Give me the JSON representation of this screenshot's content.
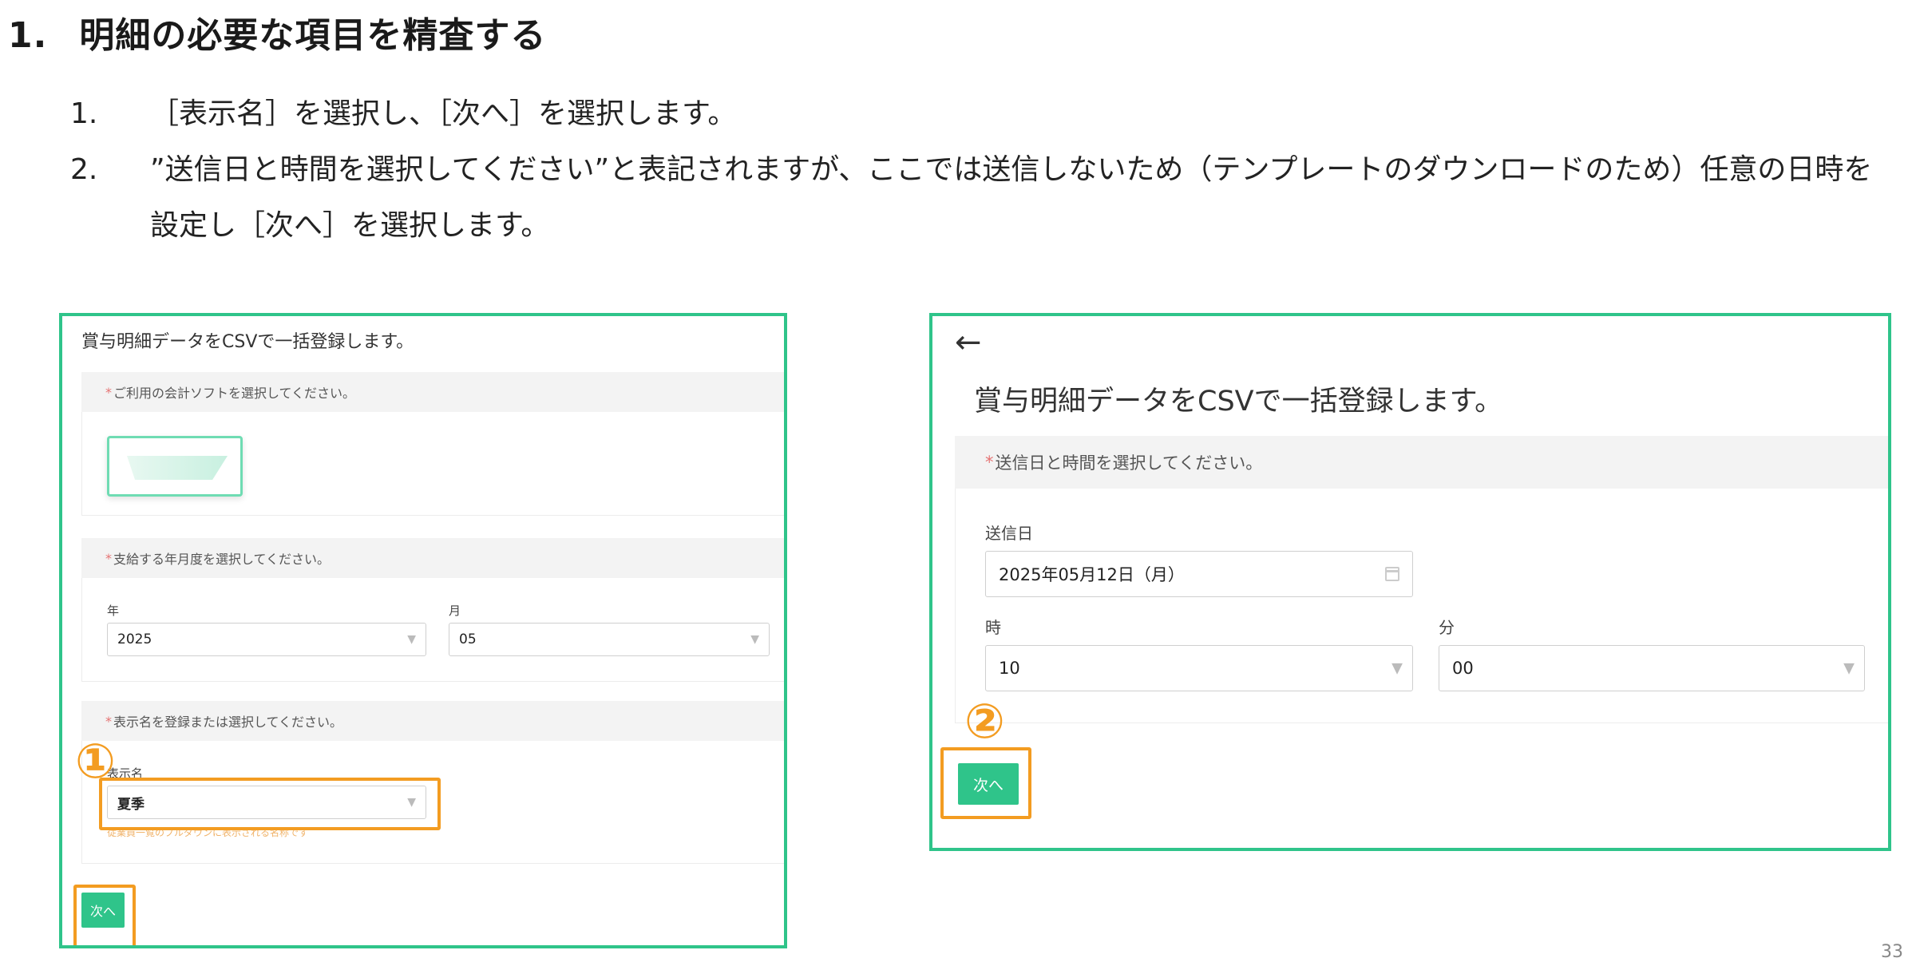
{
  "heading": {
    "number": "1.",
    "text": "明細の必要な項目を精査する"
  },
  "steps": [
    {
      "n": "1.",
      "text": "［表示名］を選択し、［次へ］を選択します。"
    },
    {
      "n": "2.",
      "text": "”送信日と時間を選択してください”と表記されますが、ここでは送信しないため（テンプレートのダウンロードのため）任意の日時を設定し［次へ］を選択します。"
    }
  ],
  "left": {
    "title": "賞与明細データをCSVで一括登録します。",
    "software_section": "ご利用の会計ソフトを選択してください。",
    "period_section": "支給する年月度を選択してください。",
    "year_label": "年",
    "year_value": "2025",
    "month_label": "月",
    "month_value": "05",
    "display_section": "表示名を登録または選択してください。",
    "display_label": "表示名",
    "display_value": "夏季",
    "hint": "従業員一覧のプルダウンに表示される名称です",
    "next_label": "次へ",
    "marker": "①",
    "required_mark": "*"
  },
  "right": {
    "back": "←",
    "title": "賞与明細データをCSVで一括登録します。",
    "section": "送信日と時間を選択してください。",
    "date_label": "送信日",
    "date_value": "2025年05月12日（月）",
    "hour_label": "時",
    "hour_value": "10",
    "minute_label": "分",
    "minute_value": "00",
    "next_label": "次へ",
    "marker": "②",
    "required_mark": "*"
  },
  "caret": "▼",
  "page_number": "33",
  "colors": {
    "accent": "#2fc48a",
    "highlight": "#f39c21",
    "required": "#e57373"
  }
}
